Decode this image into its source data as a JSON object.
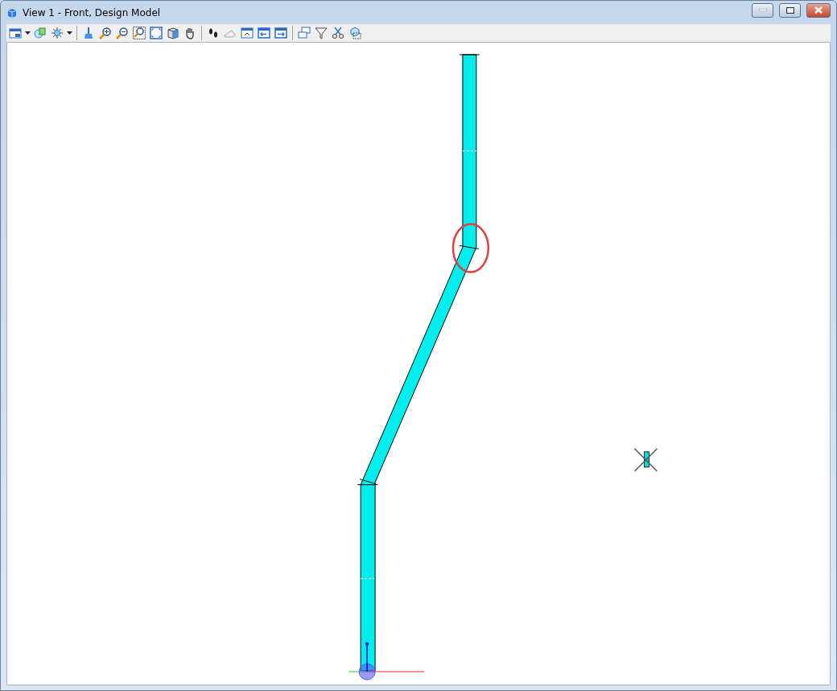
{
  "window": {
    "title": "View 1 - Front, Design Model"
  }
}
